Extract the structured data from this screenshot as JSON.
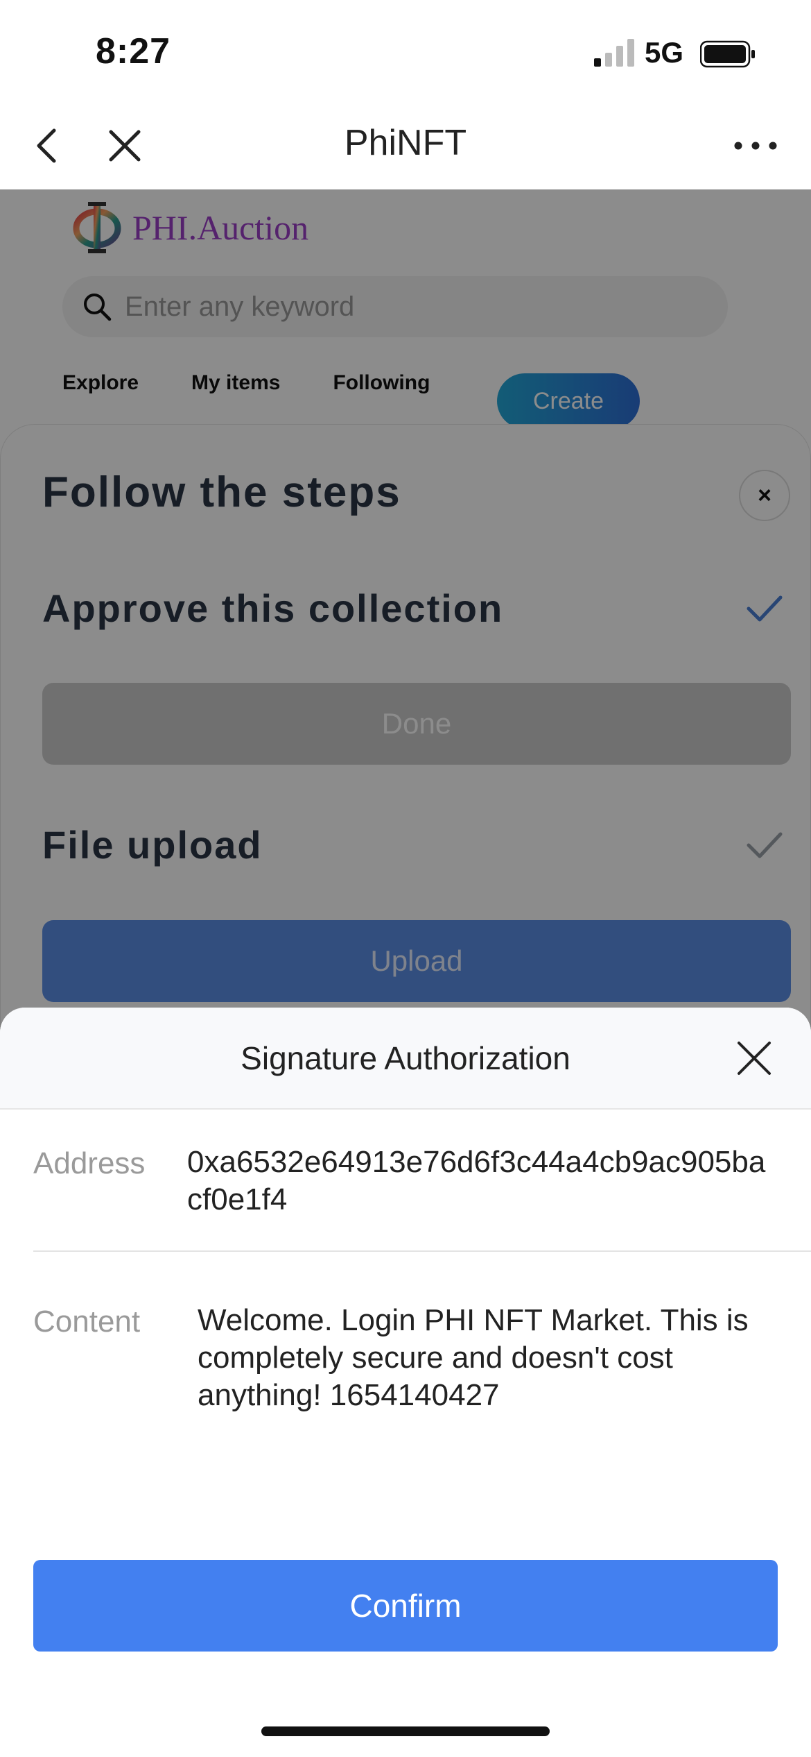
{
  "status_bar": {
    "time": "8:27",
    "network": "5G"
  },
  "nav": {
    "title": "PhiNFT"
  },
  "site": {
    "logo_text": "PHI.Auction",
    "search_placeholder": "Enter any keyword",
    "tabs": [
      "Explore",
      "My items",
      "Following"
    ],
    "create_label": "Create"
  },
  "steps_modal": {
    "title": "Follow the steps",
    "close_symbol": "×",
    "steps": [
      {
        "label": "Approve this collection",
        "button": "Done",
        "completed": true
      },
      {
        "label": "File upload",
        "button": "Upload",
        "completed": true
      }
    ]
  },
  "signature": {
    "title": "Signature Authorization",
    "address_label": "Address",
    "address_value": "0xa6532e64913e76d6f3c44a4cb9ac905bacf0e1f4",
    "content_label": "Content",
    "content_value": "Welcome. Login PHI NFT Market. This is completely secure and doesn't cost anything! 1654140427",
    "confirm_label": "Confirm"
  },
  "colors": {
    "accent": "#4380f0",
    "logo": "#9b3fc7",
    "check": "#4a7fd4"
  }
}
